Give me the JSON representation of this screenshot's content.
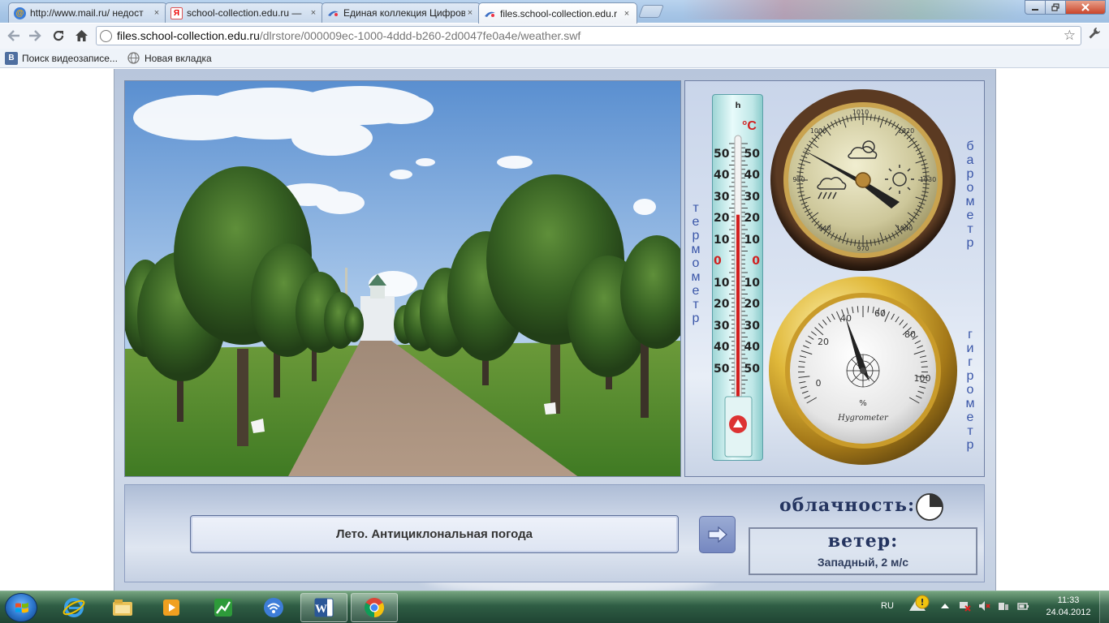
{
  "browser": {
    "tabs": [
      {
        "title": "http://www.mail.ru/ недост",
        "icon": "mail-ru-icon",
        "active": false
      },
      {
        "title": "school-collection.edu.ru —",
        "icon": "yandex-icon",
        "active": false
      },
      {
        "title": "Единая коллекция Цифров",
        "icon": "collection-icon",
        "active": false
      },
      {
        "title": "files.school-collection.edu.r",
        "icon": "collection-icon",
        "active": true
      }
    ],
    "tab_close": "×",
    "url_host": "files.school-collection.edu.ru",
    "url_path": "/dlrstore/000009ec-1000-4ddd-b260-2d0047fe0a4e/weather.swf",
    "bookmarks": [
      {
        "label": "Поиск видеозаписе...",
        "icon": "vk-icon"
      },
      {
        "label": "Новая вкладка",
        "icon": "globe-icon"
      }
    ]
  },
  "app": {
    "instruments": {
      "thermometer_label": "термометр",
      "barometer_label": "барометр",
      "hygrometer_label": "гигрометр",
      "thermometer_unit": "°C",
      "thermometer_scale_top": [
        "50",
        "40",
        "30",
        "20",
        "10",
        "0"
      ],
      "thermometer_scale_bottom": [
        "10",
        "20",
        "30",
        "40",
        "50"
      ],
      "thermometer_reading": 22,
      "hygrometer_reading_percent": 40,
      "barometer_brand": "",
      "hygrometer_brand": "Hygrometer",
      "hygrometer_unit": "%"
    },
    "season_text": "Лето. Антициклональная погода",
    "cloudiness_label": "облачность:",
    "cloudiness_fraction": 0.25,
    "wind_label": "ветер:",
    "wind_value": "Западный, 2 м/с"
  },
  "taskbar": {
    "language": "RU",
    "time": "11:33",
    "date": "24.04.2012"
  },
  "colors": {
    "accent_blue": "#3a56a8",
    "panel_text": "#253560",
    "thermo_red": "#d11f1f"
  }
}
